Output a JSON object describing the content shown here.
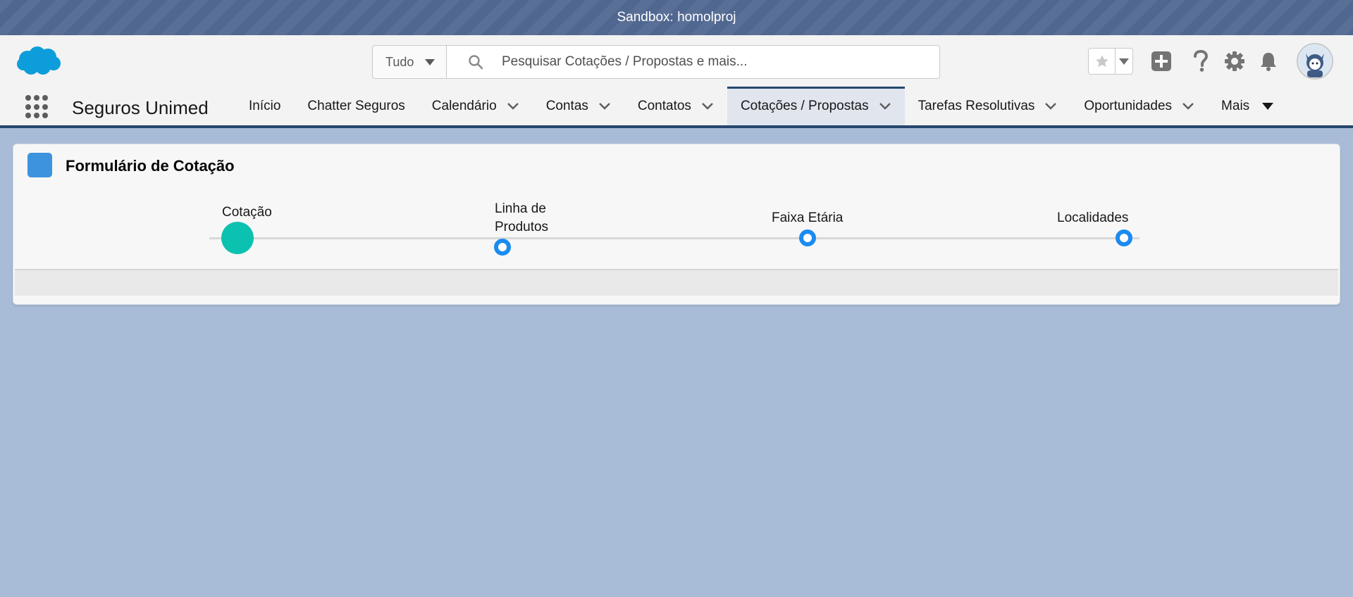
{
  "sandbox_banner": {
    "text": "Sandbox: homolproj"
  },
  "header": {
    "logo_icon": "salesforce-cloud-logo",
    "search_scope": "Tudo",
    "search_placeholder": "Pesquisar Cotações / Propostas e mais...",
    "actions": [
      "favorites-star-icon",
      "add-icon",
      "help-icon",
      "setup-gear-icon",
      "notifications-bell-icon",
      "user-avatar"
    ]
  },
  "nav": {
    "app_name": "Seguros Unimed",
    "items": [
      {
        "label": "Início",
        "has_menu": false
      },
      {
        "label": "Chatter Seguros",
        "has_menu": false
      },
      {
        "label": "Calendário",
        "has_menu": true
      },
      {
        "label": "Contas",
        "has_menu": true
      },
      {
        "label": "Contatos",
        "has_menu": true
      },
      {
        "label": "Cotações / Propostas",
        "has_menu": true,
        "active": true
      },
      {
        "label": "Tarefas Resolutivas",
        "has_menu": true
      },
      {
        "label": "Oportunidades",
        "has_menu": true
      },
      {
        "label": "Mais",
        "has_menu": true
      }
    ]
  },
  "card": {
    "title": "Formulário de Cotação",
    "steps": [
      {
        "label": "Cotação",
        "status": "complete"
      },
      {
        "label": "Linha de Produtos",
        "status": "open"
      },
      {
        "label": "Faixa Etária",
        "status": "open"
      },
      {
        "label": "Localidades",
        "status": "open"
      }
    ]
  },
  "colors": {
    "page_background": "#a9bcd7",
    "sandbox_banner": "#506790",
    "nav_active_border": "#25476e",
    "step_complete": "#0bc1b0",
    "step_open": "#1b8bf0",
    "card_icon": "#3d93de"
  }
}
